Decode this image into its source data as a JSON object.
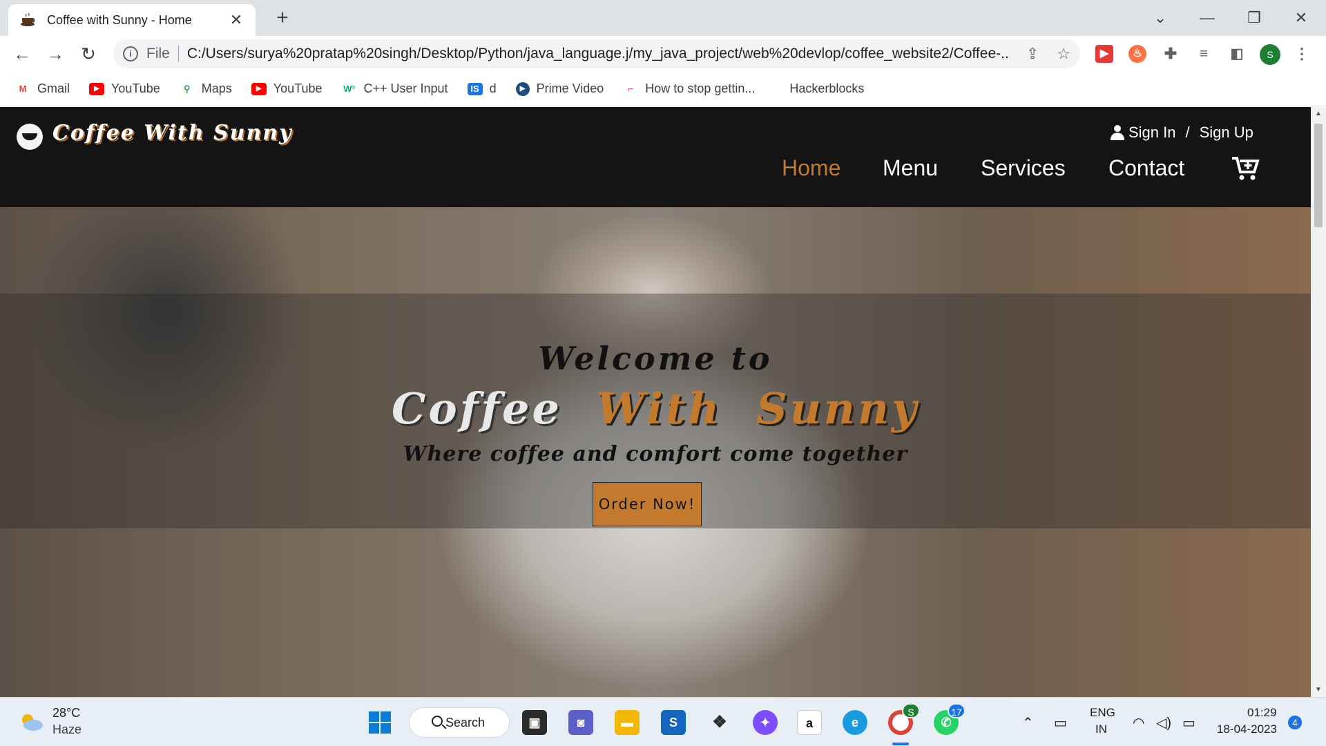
{
  "browser": {
    "tab_title": "Coffee with Sunny - Home",
    "url_scheme": "File",
    "url": "C:/Users/surya%20pratap%20singh/Desktop/Python/java_language.j/my_java_project/web%20devlop/coffee_website2/Coffee-...",
    "profile_initial": "S",
    "bookmarks": [
      {
        "label": "Gmail",
        "icon": "gmail-icon"
      },
      {
        "label": "YouTube",
        "icon": "youtube-icon"
      },
      {
        "label": "Maps",
        "icon": "maps-icon"
      },
      {
        "label": "YouTube",
        "icon": "youtube-icon"
      },
      {
        "label": "C++ User Input",
        "icon": "w3schools-icon"
      },
      {
        "label": "d",
        "icon": "is-icon"
      },
      {
        "label": "Prime Video",
        "icon": "prime-video-icon"
      },
      {
        "label": "How to stop gettin...",
        "icon": "bracket-icon"
      },
      {
        "label": "Hackerblocks",
        "icon": ""
      }
    ]
  },
  "site": {
    "logo_text": "Coffee With Sunny",
    "auth": {
      "sign_in": "Sign In",
      "separator": "/",
      "sign_up": "Sign Up"
    },
    "menu": [
      "Home",
      "Menu",
      "Services",
      "Contact"
    ],
    "active_menu": "Home",
    "hero": {
      "welcome": "Welcome to",
      "brand_words": [
        "Coffee",
        "With",
        "Sunny"
      ],
      "tagline": "Where coffee and comfort come together",
      "cta": "Order Now!"
    },
    "colors": {
      "accent": "#c47a2c",
      "nav_bg": "#141414"
    }
  },
  "taskbar": {
    "weather_temp": "28°C",
    "weather_desc": "Haze",
    "search_label": "Search",
    "whatsapp_badge": "17",
    "chrome_badge": "S",
    "language": "ENG",
    "region": "IN",
    "time": "01:29",
    "date": "18-04-2023",
    "notification_count": "4"
  }
}
